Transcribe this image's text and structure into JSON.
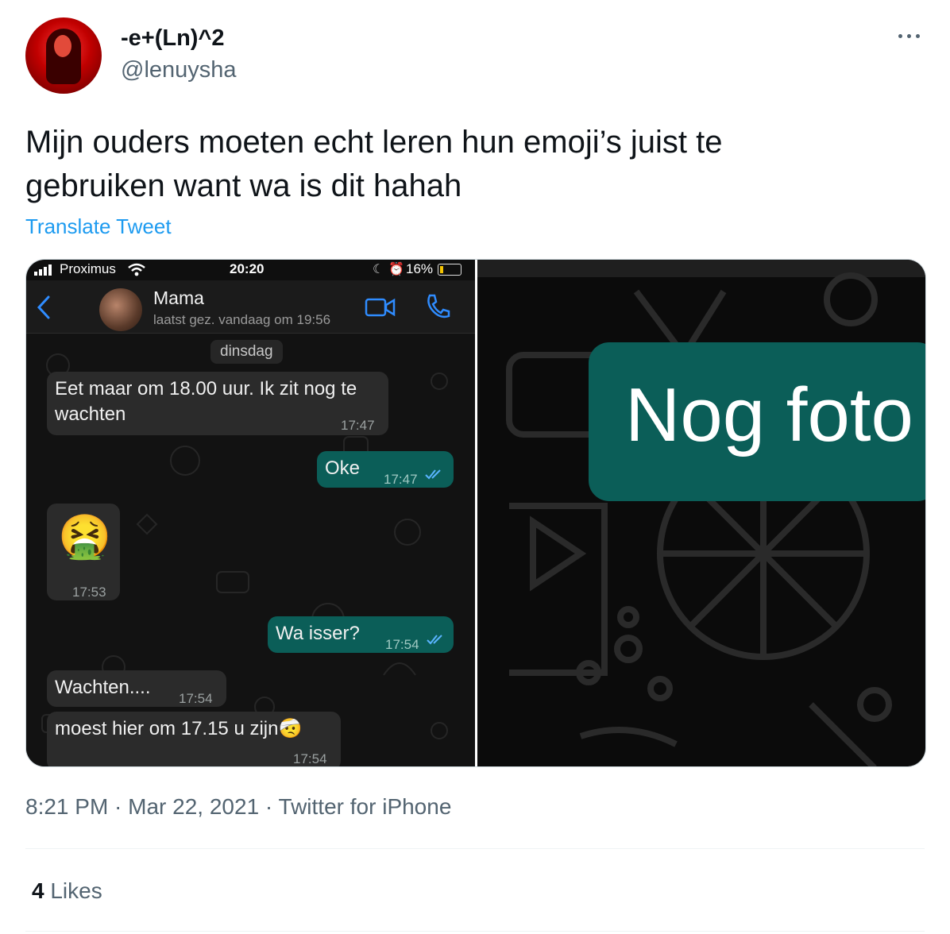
{
  "tweet": {
    "display_name": "-e+(Ln)^2",
    "handle": "@lenuysha",
    "text_line1": "Mijn ouders moeten echt leren hun emoji’s juist te",
    "text_line2": "gebruiken want wa is dit hahah",
    "translate_label": "Translate Tweet",
    "timestamp": "8:21 PM · Mar 22, 2021 · Twitter for iPhone",
    "likes_count": "4",
    "likes_label": "Likes"
  },
  "icons": [
    "more-options-icon",
    "back-arrow-icon",
    "video-call-icon",
    "phone-call-icon",
    "wifi-icon",
    "signal-icon",
    "battery-icon",
    "double-check-icon"
  ],
  "colors": {
    "link": "#1d9bf0",
    "secondary_text": "#536471",
    "whatsapp_out": "#0b5e58",
    "whatsapp_in": "#2b2b2b"
  },
  "phone": {
    "carrier": "Proximus",
    "clock": "20:20",
    "battery": "16%",
    "contact_name": "Mama",
    "last_seen": "laatst gez. vandaag om 19:56",
    "day_label": "dinsdag",
    "messages": [
      {
        "text": "Eet maar om 18.00 uur. Ik zit nog te",
        "text2": "wachten",
        "time": "17:47"
      },
      {
        "text": "Oke",
        "time": "17:47"
      },
      {
        "emoji": "🤮",
        "time": "17:53"
      },
      {
        "text": "Wa isser?",
        "time": "17:54"
      },
      {
        "text": "Wachten....",
        "time": "17:54"
      },
      {
        "text": "moest hier om 17.15 u zijn🤕",
        "time": "17:54"
      }
    ]
  },
  "zoom_image": {
    "text": "Nog foto"
  }
}
